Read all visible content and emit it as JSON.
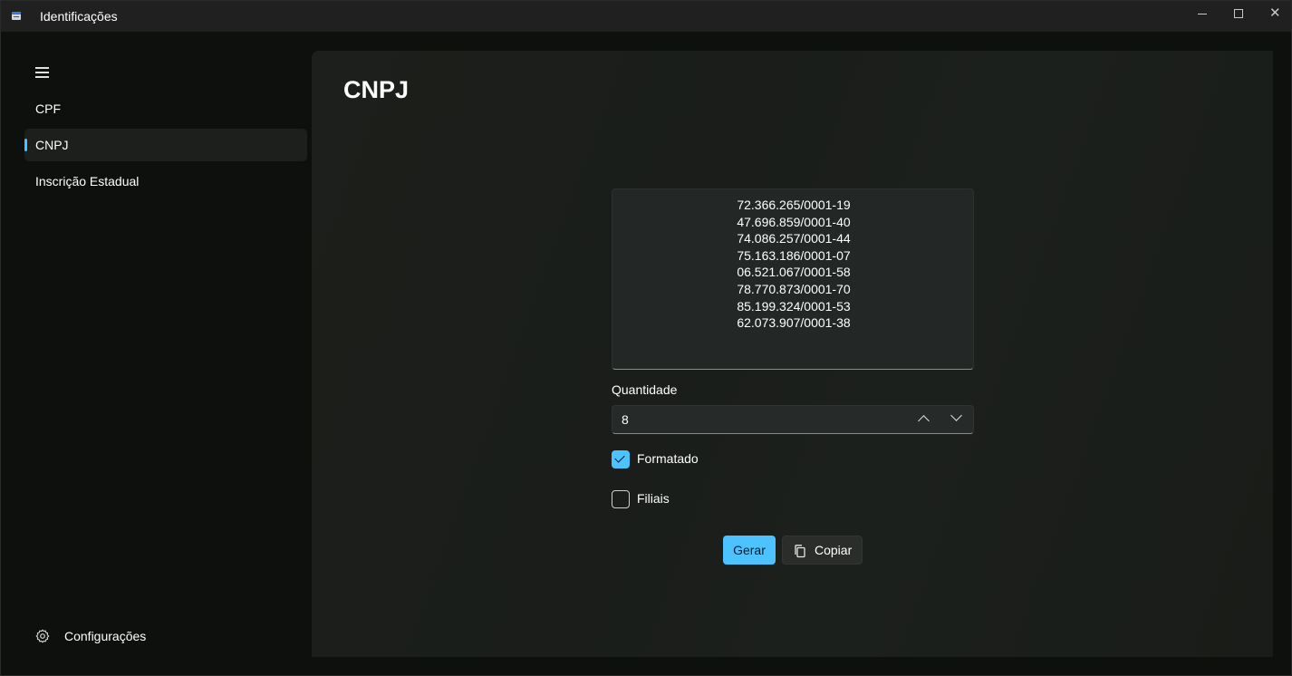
{
  "window": {
    "title": "Identificações",
    "icon": "app-icon"
  },
  "sidebar": {
    "menu_icon": "hamburger-icon",
    "items": [
      {
        "label": "CPF",
        "active": false
      },
      {
        "label": "CNPJ",
        "active": true
      },
      {
        "label": "Inscrição Estadual",
        "active": false
      }
    ],
    "settings": {
      "label": "Configurações",
      "icon": "gear-icon"
    }
  },
  "main": {
    "title": "CNPJ",
    "output": [
      "72.366.265/0001-19",
      "47.696.859/0001-40",
      "74.086.257/0001-44",
      "75.163.186/0001-07",
      "06.521.067/0001-58",
      "78.770.873/0001-70",
      "85.199.324/0001-53",
      "62.073.907/0001-38"
    ],
    "quantity": {
      "label": "Quantidade",
      "value": "8"
    },
    "options": [
      {
        "label": "Formatado",
        "checked": true
      },
      {
        "label": "Filiais",
        "checked": false
      }
    ],
    "buttons": {
      "generate": "Gerar",
      "copy": "Copiar"
    }
  },
  "colors": {
    "accent": "#4cc2ff",
    "background": "#0d100c",
    "panel": "#1c1f1b"
  }
}
